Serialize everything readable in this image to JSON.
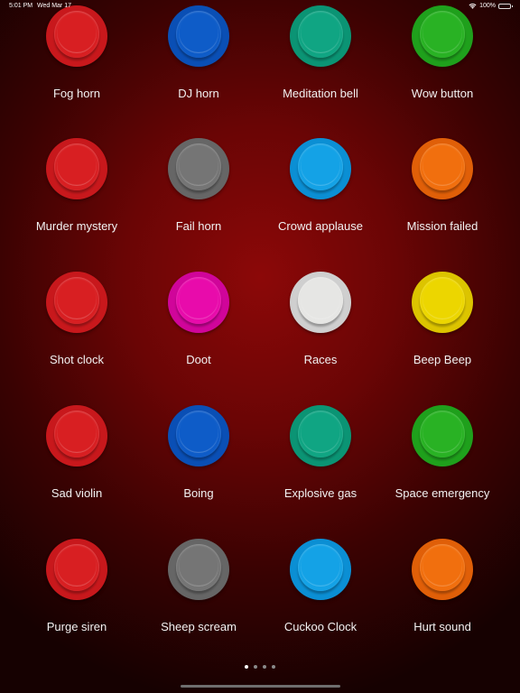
{
  "status_bar": {
    "time": "5:01 PM",
    "date": "Wed Mar 17",
    "battery": "100%",
    "icons": [
      "wifi-icon",
      "battery-icon"
    ]
  },
  "palette": {
    "red": {
      "ring": "#c8181c",
      "cap": "#d81f22"
    },
    "blue": {
      "ring": "#0a4fb5",
      "cap": "#0e5cc8"
    },
    "teal": {
      "ring": "#0b9474",
      "cap": "#10a583"
    },
    "green": {
      "ring": "#1fa01c",
      "cap": "#29b224"
    },
    "gray": {
      "ring": "#666666",
      "cap": "#757575"
    },
    "sky": {
      "ring": "#0b8fd4",
      "cap": "#14a2e6"
    },
    "orange": {
      "ring": "#e05f08",
      "cap": "#f16f0e"
    },
    "pink": {
      "ring": "#d0059a",
      "cap": "#e80bab"
    },
    "white": {
      "ring": "#cfcfcf",
      "cap": "#e6e6e4"
    },
    "yellow": {
      "ring": "#dcc400",
      "cap": "#ecd600"
    }
  },
  "sound_buttons": [
    {
      "label": "Fog horn",
      "color": "red"
    },
    {
      "label": "DJ horn",
      "color": "blue"
    },
    {
      "label": "Meditation bell",
      "color": "teal"
    },
    {
      "label": "Wow button",
      "color": "green"
    },
    {
      "label": "Murder mystery",
      "color": "red"
    },
    {
      "label": "Fail horn",
      "color": "gray"
    },
    {
      "label": "Crowd applause",
      "color": "sky"
    },
    {
      "label": "Mission failed",
      "color": "orange"
    },
    {
      "label": "Shot clock",
      "color": "red"
    },
    {
      "label": "Doot",
      "color": "pink"
    },
    {
      "label": "Races",
      "color": "white"
    },
    {
      "label": "Beep Beep",
      "color": "yellow"
    },
    {
      "label": "Sad violin",
      "color": "red"
    },
    {
      "label": "Boing",
      "color": "blue"
    },
    {
      "label": "Explosive gas",
      "color": "teal"
    },
    {
      "label": "Space emergency",
      "color": "green"
    },
    {
      "label": "Purge siren",
      "color": "red"
    },
    {
      "label": "Sheep scream",
      "color": "gray"
    },
    {
      "label": "Cuckoo Clock",
      "color": "sky"
    },
    {
      "label": "Hurt sound",
      "color": "orange"
    }
  ],
  "pagination": {
    "pages": 4,
    "current": 1
  }
}
